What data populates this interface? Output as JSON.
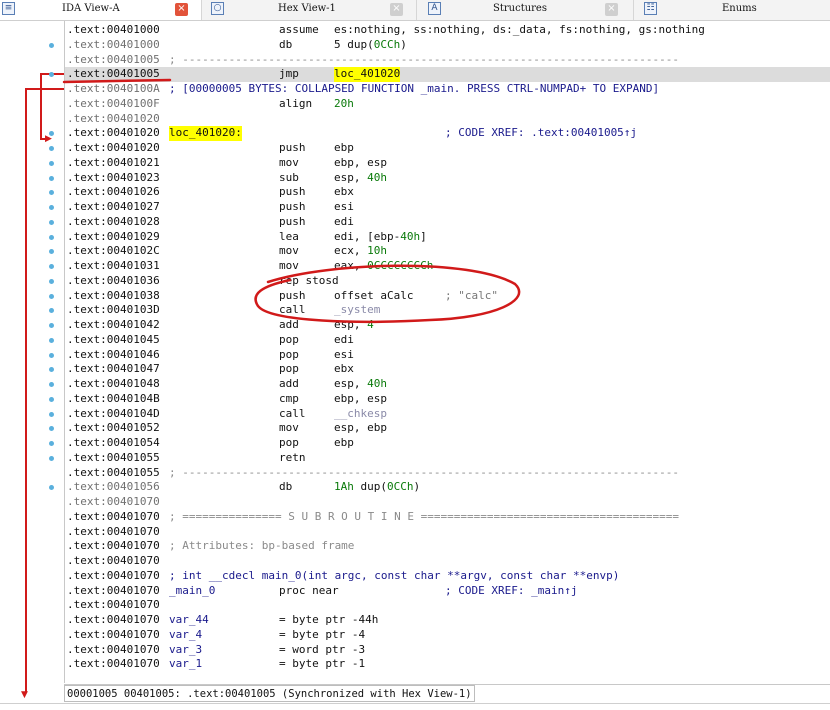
{
  "tabs": [
    {
      "label": "IDA View-A",
      "icon": "listing-icon",
      "active": true
    },
    {
      "label": "Hex View-1",
      "icon": "hex-icon",
      "active": false
    },
    {
      "label": "Structures",
      "icon": "structures-icon",
      "active": false
    },
    {
      "label": "Enums",
      "icon": "enums-icon",
      "active": false
    }
  ],
  "listing": [
    {
      "addr": ".text:00401000",
      "mn": "assume",
      "op": "es:nothing, ss:nothing, ds:_data, fs:nothing, gs:nothing"
    },
    {
      "addr": ".text:00401000",
      "mn": "db",
      "op": "5 dup(0CCh)"
    },
    {
      "addr": ".text:00401005",
      "rest": "; ---------------------------------------------------------------------------"
    },
    {
      "addr": ".text:00401005",
      "mn": "jmp",
      "op": "loc_401020"
    },
    {
      "addr": ".text:0040100A",
      "rest": "; [00000005 BYTES: COLLAPSED FUNCTION _main. PRESS CTRL-NUMPAD+ TO EXPAND]"
    },
    {
      "addr": ".text:0040100F",
      "mn": "align",
      "op": "20h"
    },
    {
      "addr": ".text:00401020"
    },
    {
      "addr": ".text:00401020",
      "label": "loc_401020:",
      "cmt": "; CODE XREF: .text:00401005↑j"
    },
    {
      "addr": ".text:00401020",
      "mn": "push",
      "op": "ebp"
    },
    {
      "addr": ".text:00401021",
      "mn": "mov",
      "op": "ebp, esp"
    },
    {
      "addr": ".text:00401023",
      "mn": "sub",
      "op": "esp, 40h"
    },
    {
      "addr": ".text:00401026",
      "mn": "push",
      "op": "ebx"
    },
    {
      "addr": ".text:00401027",
      "mn": "push",
      "op": "esi"
    },
    {
      "addr": ".text:00401028",
      "mn": "push",
      "op": "edi"
    },
    {
      "addr": ".text:00401029",
      "mn": "lea",
      "op": "edi, [ebp-40h]"
    },
    {
      "addr": ".text:0040102C",
      "mn": "mov",
      "op": "ecx, 10h"
    },
    {
      "addr": ".text:00401031",
      "mn": "mov",
      "op": "eax, 0CCCCCCCCh"
    },
    {
      "addr": ".text:00401036",
      "mn": "rep stosd"
    },
    {
      "addr": ".text:00401038",
      "mn": "push",
      "op": "offset aCalc",
      "cmt": "; \"calc\""
    },
    {
      "addr": ".text:0040103D",
      "mn": "call",
      "op": "_system"
    },
    {
      "addr": ".text:00401042",
      "mn": "add",
      "op": "esp, 4"
    },
    {
      "addr": ".text:00401045",
      "mn": "pop",
      "op": "edi"
    },
    {
      "addr": ".text:00401046",
      "mn": "pop",
      "op": "esi"
    },
    {
      "addr": ".text:00401047",
      "mn": "pop",
      "op": "ebx"
    },
    {
      "addr": ".text:00401048",
      "mn": "add",
      "op": "esp, 40h"
    },
    {
      "addr": ".text:0040104B",
      "mn": "cmp",
      "op": "ebp, esp"
    },
    {
      "addr": ".text:0040104D",
      "mn": "call",
      "op": "__chkesp"
    },
    {
      "addr": ".text:00401052",
      "mn": "mov",
      "op": "esp, ebp"
    },
    {
      "addr": ".text:00401054",
      "mn": "pop",
      "op": "ebp"
    },
    {
      "addr": ".text:00401055",
      "mn": "retn"
    },
    {
      "addr": ".text:00401055",
      "rest": "; ---------------------------------------------------------------------------"
    },
    {
      "addr": ".text:00401056",
      "mn": "db",
      "op": "1Ah dup(0CCh)"
    },
    {
      "addr": ".text:00401070"
    },
    {
      "addr": ".text:00401070",
      "rest": "; =============== S U B R O U T I N E ======================================="
    },
    {
      "addr": ".text:00401070"
    },
    {
      "addr": ".text:00401070",
      "rest": "; Attributes: bp-based frame"
    },
    {
      "addr": ".text:00401070"
    },
    {
      "addr": ".text:00401070",
      "rest": "; int __cdecl main_0(int argc, const char **argv, const char **envp)"
    },
    {
      "addr": ".text:00401070",
      "label": "_main_0",
      "mn": "proc near",
      "cmt": "; CODE XREF: _main↑j"
    },
    {
      "addr": ".text:00401070"
    },
    {
      "addr": ".text:00401070",
      "label": "var_44",
      "mn": "= byte ptr -44h"
    },
    {
      "addr": ".text:00401070",
      "label": "var_4",
      "mn": "= byte ptr -4"
    },
    {
      "addr": ".text:00401070",
      "label": "var_3",
      "mn": "= word ptr -3"
    },
    {
      "addr": ".text:00401070",
      "label": "var_1",
      "mn": "= byte ptr -1"
    }
  ],
  "status": {
    "text": "00001005 00401005: .text:00401005 (Synchronized with Hex View-1)"
  },
  "colors": {
    "annotation_red": "#d11a1a",
    "highlight_yellow": "#ffff00",
    "ida_blue": "#1a1a8c",
    "ida_green": "#0a7a0a"
  }
}
